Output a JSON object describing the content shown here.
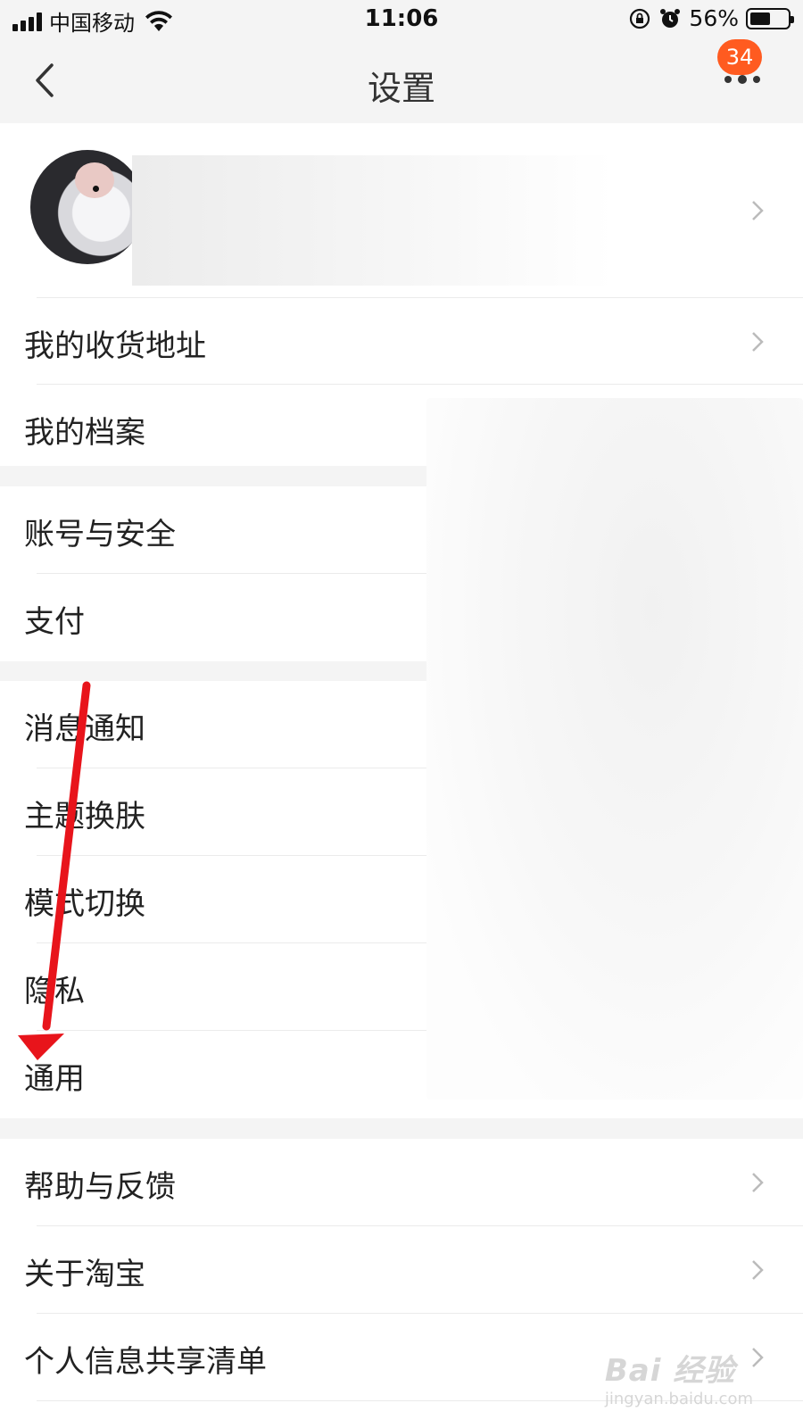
{
  "status_bar": {
    "carrier": "中国移动",
    "time": "11:06",
    "battery": "56%",
    "battery_level": 0.56
  },
  "nav": {
    "title": "设置",
    "badge_count": "34",
    "back_icon": "chevron-left-icon",
    "more_icon": "more-dots-icon"
  },
  "groups": [
    {
      "rows": [
        "我的收货地址",
        "我的档案"
      ]
    },
    {
      "rows": [
        "账号与安全",
        "支付"
      ]
    },
    {
      "rows": [
        "消息通知",
        "主题换肤",
        "模式切换",
        "隐私",
        "通用"
      ]
    },
    {
      "rows": [
        "帮助与反馈",
        "关于淘宝",
        "个人信息共享清单"
      ]
    }
  ],
  "colors": {
    "badge": "#ff5b20",
    "arrow": "#e8141b",
    "background": "#f4f4f4"
  },
  "watermark": {
    "main": "Bai 经验",
    "sub": "jingyan.baidu.com"
  }
}
